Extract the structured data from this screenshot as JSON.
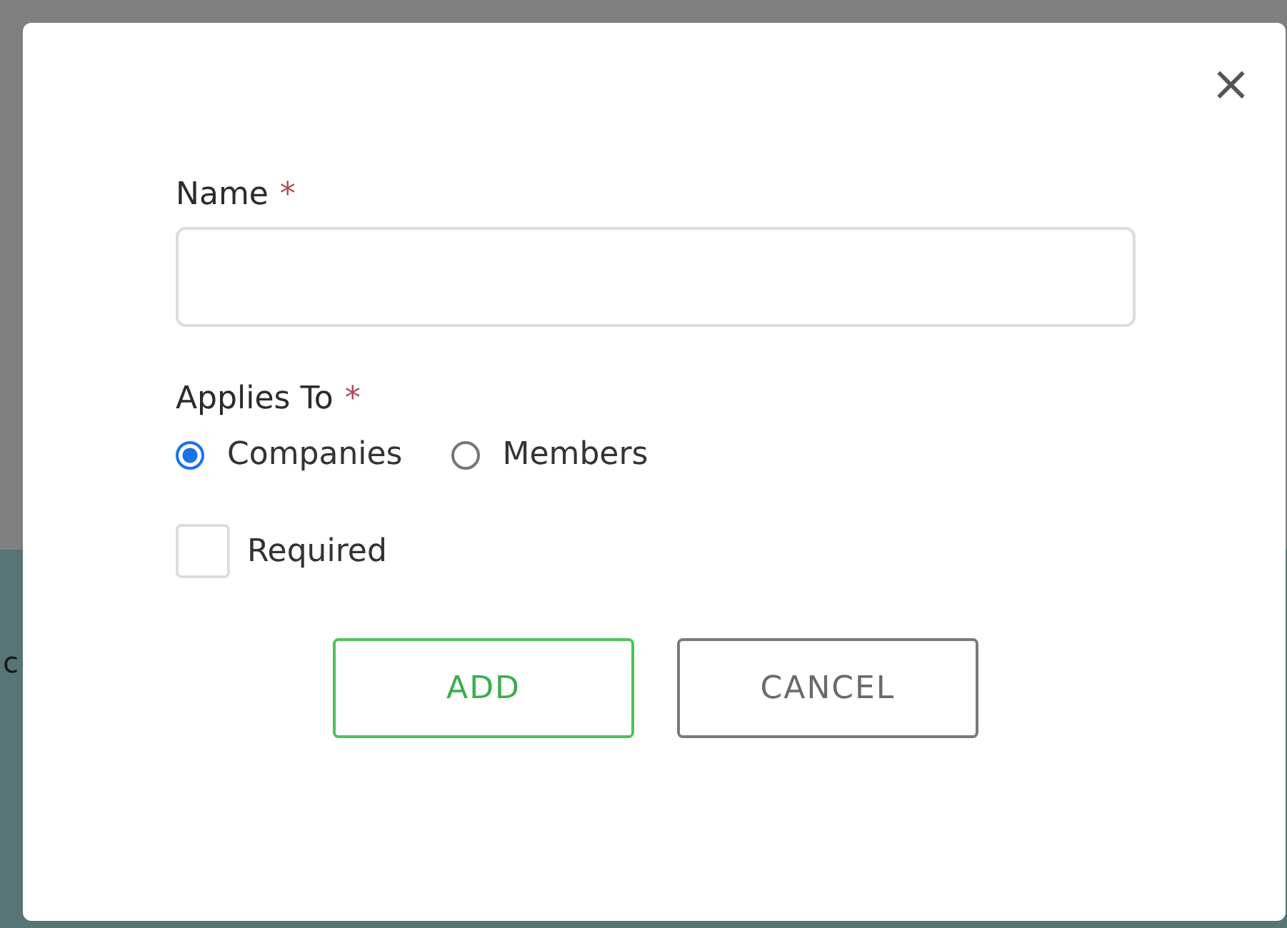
{
  "background_text": "c",
  "dialog": {
    "close": "×",
    "name_field": {
      "label": "Name",
      "required_mark": "*"
    },
    "applies_to": {
      "label": "Applies To",
      "required_mark": "*",
      "options": [
        {
          "label": "Companies",
          "selected": true
        },
        {
          "label": "Members",
          "selected": false
        }
      ]
    },
    "required_checkbox": {
      "label": "Required",
      "checked": false
    },
    "buttons": [
      {
        "label": "ADD",
        "kind": "primary"
      },
      {
        "label": "CANCEL",
        "kind": "secondary"
      }
    ]
  }
}
